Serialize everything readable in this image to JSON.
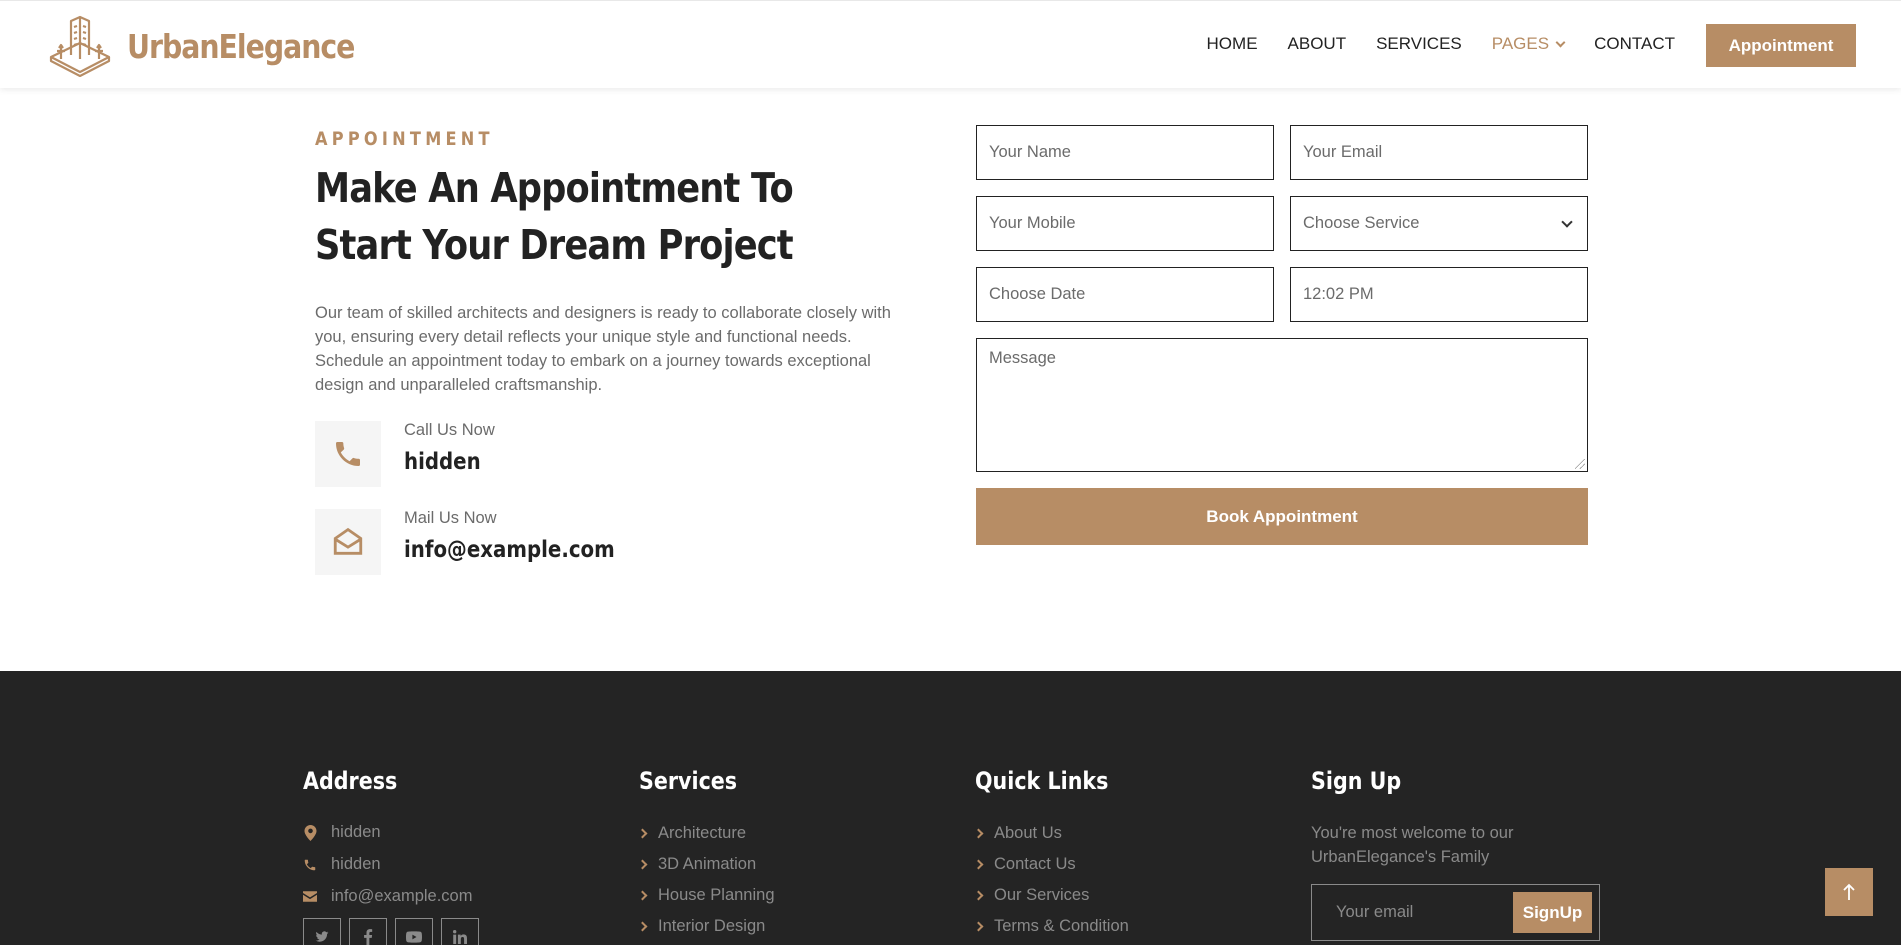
{
  "brand": {
    "name": "UrbanElegance"
  },
  "nav": {
    "items": [
      {
        "label": "HOME"
      },
      {
        "label": "ABOUT"
      },
      {
        "label": "SERVICES"
      },
      {
        "label": "PAGES"
      },
      {
        "label": "CONTACT"
      }
    ],
    "cta_label": "Appointment"
  },
  "appointment": {
    "subtitle": "APPOINTMENT",
    "heading": "Make An Appointment To Start Your Dream Project",
    "intro": "Our team of skilled architects and designers is ready to collaborate closely with you, ensuring every detail reflects your unique style and functional needs. Schedule an appointment today to embark on a journey towards exceptional design and unparalleled craftsmanship.",
    "call_label": "Call Us Now",
    "call_value": "hidden",
    "mail_label": "Mail Us Now",
    "mail_value": "info@example.com"
  },
  "form": {
    "name_placeholder": "Your Name",
    "email_placeholder": "Your Email",
    "mobile_placeholder": "Your Mobile",
    "service_selected": "Choose Service",
    "date_placeholder": "Choose Date",
    "time_value": "12:02 PM",
    "message_placeholder": "Message",
    "submit_label": "Book Appointment"
  },
  "footer": {
    "address": {
      "title": "Address",
      "location": "hidden",
      "phone": "hidden",
      "email": "info@example.com"
    },
    "services": {
      "title": "Services",
      "items": [
        "Architecture",
        "3D Animation",
        "House Planning",
        "Interior Design"
      ]
    },
    "quick_links": {
      "title": "Quick Links",
      "items": [
        "About Us",
        "Contact Us",
        "Our Services",
        "Terms & Condition"
      ]
    },
    "signup": {
      "title": "Sign Up",
      "text": "You're most welcome to our UrbanElegance's Family",
      "email_placeholder": "Your email",
      "button_label": "SignUp"
    }
  },
  "colors": {
    "accent": "#b78d65",
    "dark": "#242424",
    "text": "#222222"
  }
}
